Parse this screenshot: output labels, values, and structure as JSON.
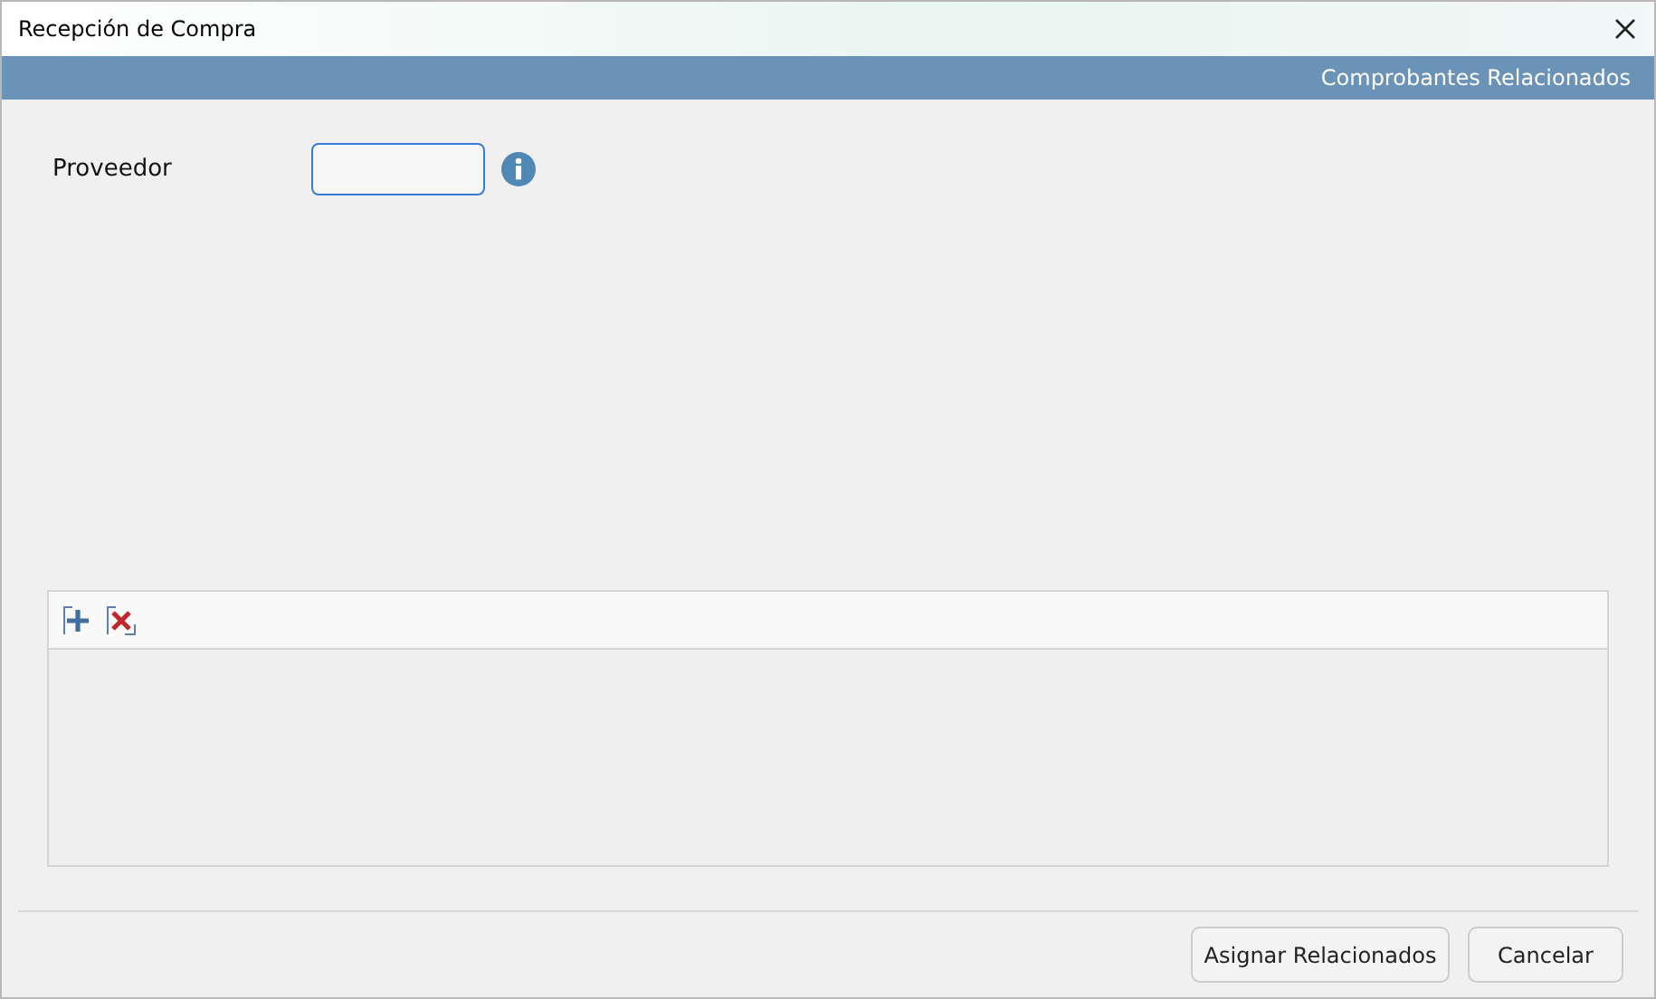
{
  "window": {
    "title": "Recepción de Compra"
  },
  "header_band": {
    "title": "Comprobantes Relacionados"
  },
  "form": {
    "label": "Proveedor"
  },
  "grid_toolbar": {
    "tools": [
      {
        "kind": "add"
      },
      {
        "kind": "delete"
      }
    ]
  },
  "buttons": [
    {
      "label": "Asignar Relacionados"
    },
    {
      "label": "Cancelar"
    }
  ]
}
